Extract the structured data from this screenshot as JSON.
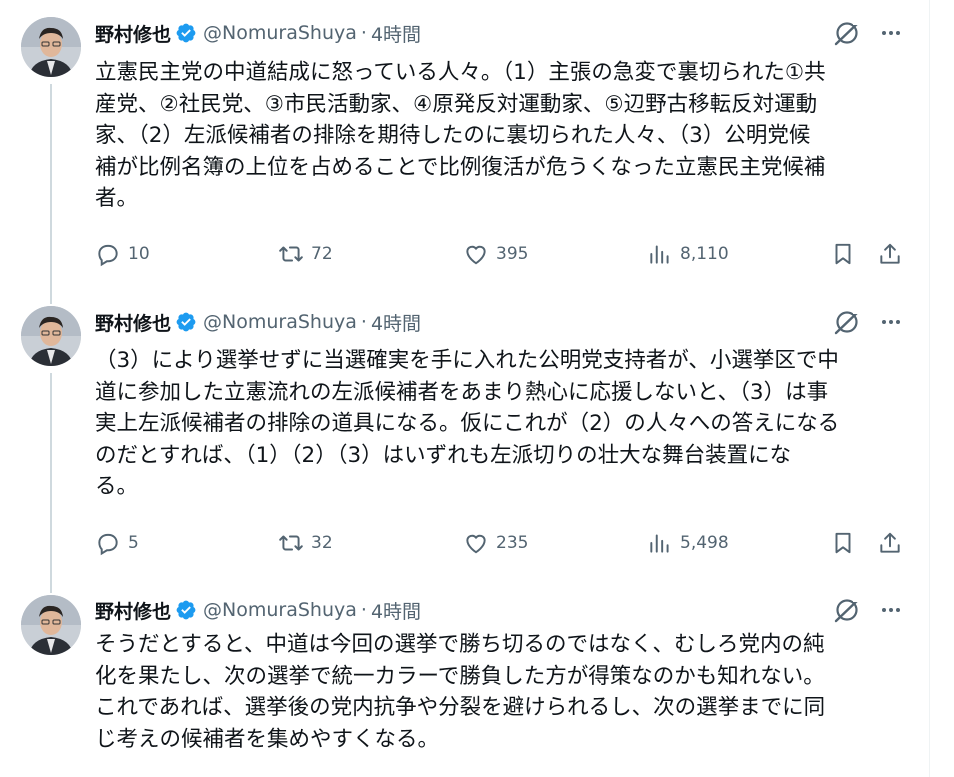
{
  "tweets": [
    {
      "name": "野村修也",
      "handle": "@NomuraShuya",
      "time": "4時間",
      "text": "立憲民主党の中道結成に怒っている人々。（1）主張の急変で裏切られた①共\n産党、②社民党、③市民活動家、④原発反対運動家、⑤辺野古移転反対運動\n家、（2）左派候補者の排除を期待したのに裏切られた人々、（3）公明党候\n補が比例名簿の上位を占めることで比例復活が危うくなった立憲民主党候補\n者。",
      "replies": "10",
      "reposts": "72",
      "likes": "395",
      "views": "8,110"
    },
    {
      "name": "野村修也",
      "handle": "@NomuraShuya",
      "time": "4時間",
      "text": "（3）により選挙せずに当選確実を手に入れた公明党支持者が、小選挙区で中\n道に参加した立憲流れの左派候補者をあまり熱心に応援しないと、（3）は事\n実上左派候補者の排除の道具になる。仮にこれが（2）の人々への答えになる\nのだとすれば、（1）（2）（3）はいずれも左派切りの壮大な舞台装置にな\nる。",
      "replies": "5",
      "reposts": "32",
      "likes": "235",
      "views": "5,498"
    },
    {
      "name": "野村修也",
      "handle": "@NomuraShuya",
      "time": "4時間",
      "text": "そうだとすると、中道は今回の選挙で勝ち切るのではなく、むしろ党内の純\n化を果たし、次の選挙で統一カラーで勝負した方が得策なのかも知れない。\nこれであれば、選挙後の党内抗争や分裂を避けられるし、次の選挙までに同\nじ考えの候補者を集めやすくなる。"
    }
  ],
  "colors": {
    "text": "#0f1419",
    "secondary": "#536471",
    "verified": "#1d9bf0",
    "thread_line": "#cfd9de"
  },
  "icons": [
    "verified-badge-icon",
    "grok-icon",
    "more-icon",
    "reply-icon",
    "repost-icon",
    "like-icon",
    "views-icon",
    "bookmark-icon",
    "share-icon"
  ]
}
